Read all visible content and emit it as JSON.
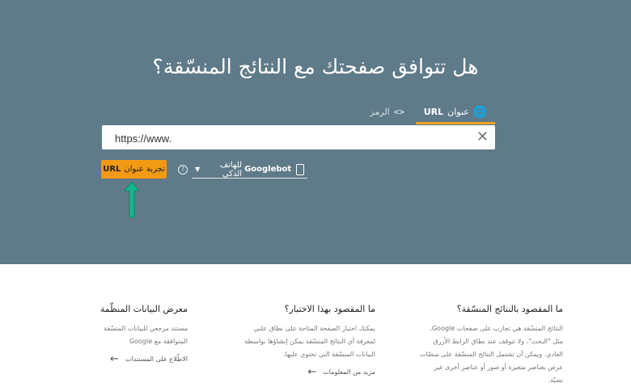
{
  "hero": {
    "title": "هل تتوافق صفحتك مع النتائج المنسّقة؟",
    "tabs": [
      {
        "label": "عنوان",
        "badge": "URL",
        "icon": "globe-icon",
        "active": true
      },
      {
        "label": "الرمز",
        "icon": "code-icon",
        "active": false
      }
    ],
    "url_input": {
      "value": "https://www.",
      "clear_icon": "close-icon"
    },
    "test_button": {
      "label": "تجربة عنوان",
      "badge": "URL"
    },
    "help_icon": "help-circle-icon",
    "agent_select": {
      "bot": "Googlebot",
      "device": "للهاتف الذكي",
      "icon": "smartphone-icon"
    }
  },
  "colors": {
    "hero_background": "#5f7a88",
    "accent": "#f29a14",
    "arrow": "#19b58f"
  },
  "columns": [
    {
      "title": "معرض البيانات المنظّمة",
      "text": "مستند مرجعي للبيانات المنسّقة المتوافقة مع Google",
      "link": "الاطّلاع على المستندات"
    },
    {
      "title": "ما المقصود بهذا الاختبار؟",
      "text": "يمكنك اختبار الصفحة المتاحة على نطاق علني لمعرفة أي النتائج المنسّقة يمكن إنشاؤها بواسطة البيانات المنسّقة التي تحتوي عليها.",
      "link": "مزيد من المعلومات"
    },
    {
      "title": "ما المقصود بالنتائج المنسّقة؟",
      "text": "النتائج المنسّقة هي تجارب على صفحات Google، مثل \"البحث\"، ولا تتوقف عند نطاق الرابط الأزرق العادي. ويمكن أن تشتمل النتائج المنسّقة على منصّات عرض بعناصر متغيرة أو صور أو عناصر أخرى غير نصيّة."
    }
  ]
}
